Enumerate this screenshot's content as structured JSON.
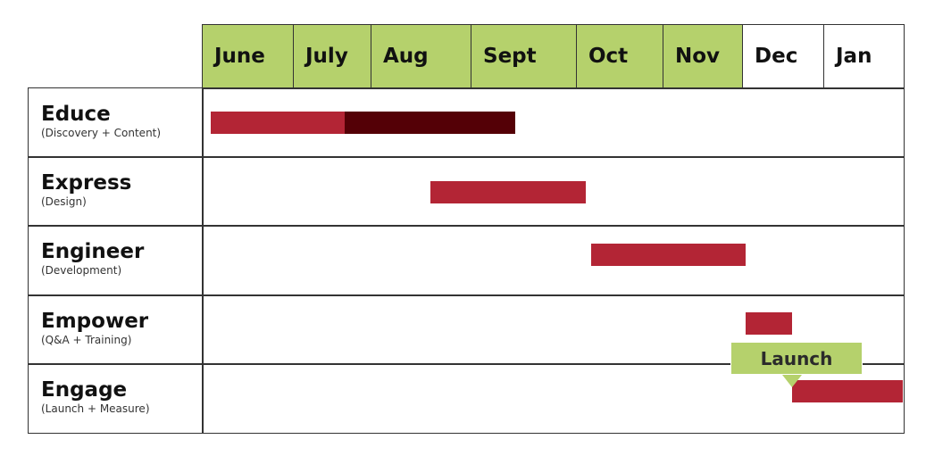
{
  "chart_data": {
    "type": "gantt",
    "months": [
      "June",
      "July",
      "Aug",
      "Sept",
      "Oct",
      "Nov",
      "Dec",
      "Jan"
    ],
    "highlighted_months": [
      "June",
      "July",
      "Aug",
      "Sept",
      "Oct",
      "Nov"
    ],
    "phases": [
      {
        "name": "Educe",
        "subtitle": "(Discovery + Content)",
        "segments": [
          {
            "start": 0.1,
            "end": 1.67,
            "color": "#b32535"
          },
          {
            "start": 1.67,
            "end": 3.42,
            "color": "#540006"
          }
        ]
      },
      {
        "name": "Express",
        "subtitle": "(Design)",
        "segments": [
          {
            "start": 2.6,
            "end": 4.11,
            "color": "#b32535"
          }
        ]
      },
      {
        "name": "Engineer",
        "subtitle": "(Development)",
        "segments": [
          {
            "start": 4.18,
            "end": 6.04,
            "color": "#b32535"
          }
        ]
      },
      {
        "name": "Empower",
        "subtitle": "(Q&A + Training)",
        "segments": [
          {
            "start": 6.04,
            "end": 6.62,
            "color": "#b32535"
          }
        ]
      },
      {
        "name": "Engage",
        "subtitle": "(Launch + Measure)",
        "segments": [
          {
            "start": 6.62,
            "end": 8.0,
            "color": "#b32535"
          }
        ]
      }
    ],
    "milestone": {
      "label": "Launch",
      "at": 6.62,
      "color": "#b5d16c"
    },
    "colors": {
      "header_green": "#b5d16c",
      "bar_red": "#b32535",
      "bar_dark": "#540006",
      "grid": "#333333"
    }
  }
}
